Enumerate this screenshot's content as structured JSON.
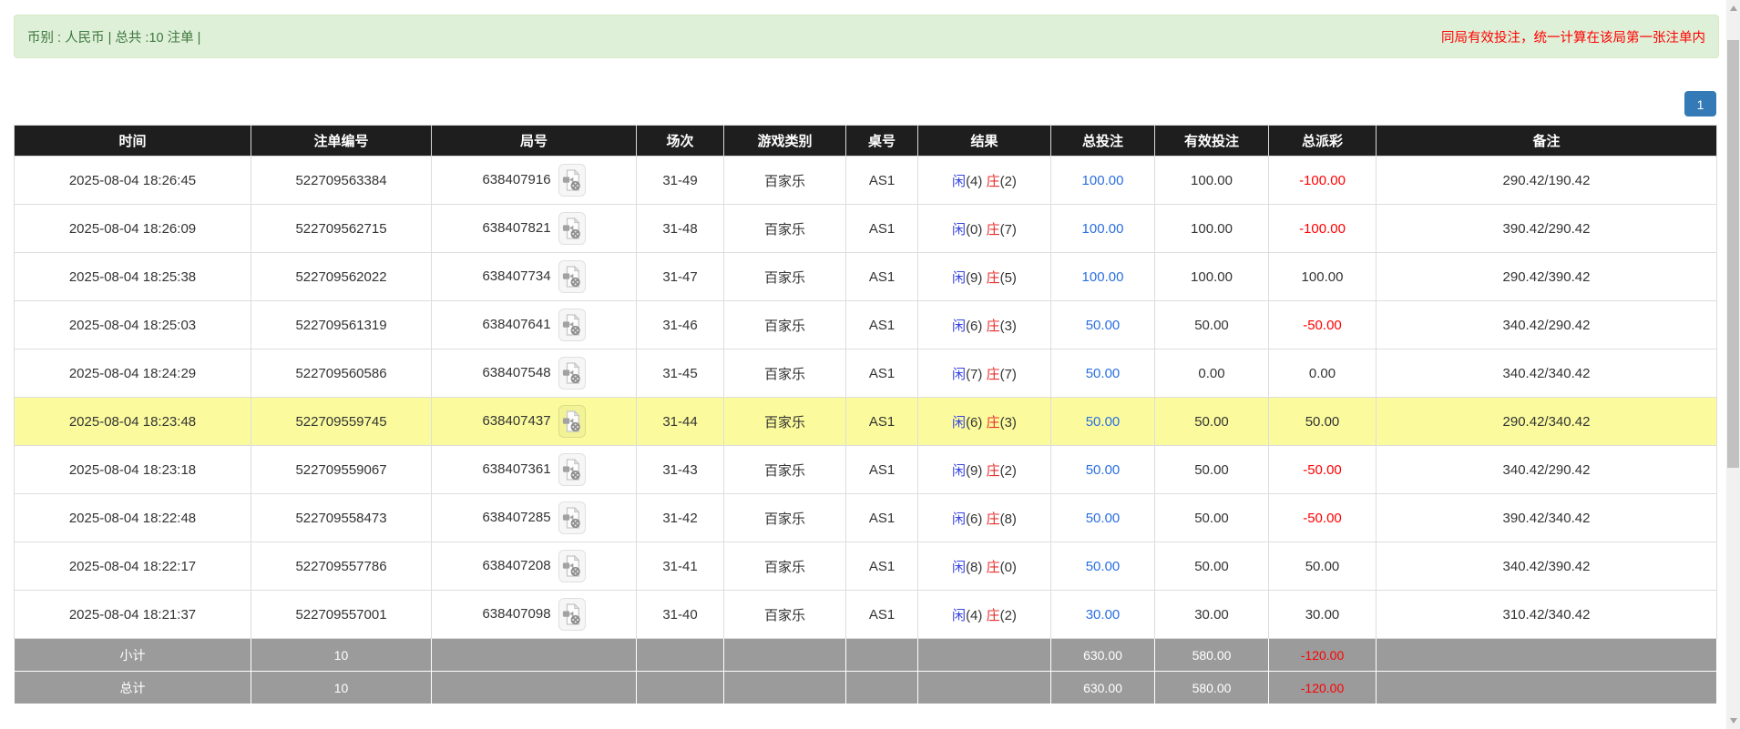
{
  "notice_bar": {
    "left_text": "币别 : 人民币 | 总共 :10 注单 |",
    "right_text": "同局有效投注，统一计算在该局第一张注单内"
  },
  "pagination": {
    "current_page": "1"
  },
  "icons": {
    "round_icon": "video-replay-icon"
  },
  "colors": {
    "notice_bg": "#dff0d8",
    "notice_border": "#d6e9c6",
    "notice_text": "#3c763d",
    "warning_red": "#ff0000",
    "header_bg": "#1e1e1e",
    "highlight_row": "#fbfb9d",
    "footer_bg": "#9b9b9b",
    "link_blue": "#2a6fe0",
    "player_blue": "#3744e0",
    "banker_red": "#e82e2e",
    "pager_blue": "#337ab7"
  },
  "table": {
    "headers": [
      "时间",
      "注单编号",
      "局号",
      "场次",
      "游戏类别",
      "桌号",
      "结果",
      "总投注",
      "有效投注",
      "总派彩",
      "备注"
    ],
    "rows": [
      {
        "time": "2025-08-04 18:26:45",
        "bet_id": "522709563384",
        "round_id": "638407916",
        "session": "31-49",
        "game_type": "百家乐",
        "table_no": "AS1",
        "result": {
          "player_label": "闲",
          "player_points": "(4)",
          "banker_label": "庄",
          "banker_points": "(2)"
        },
        "total_bet": "100.00",
        "valid_bet": "100.00",
        "payout": "-100.00",
        "remark": "290.42/190.42",
        "highlight": false
      },
      {
        "time": "2025-08-04 18:26:09",
        "bet_id": "522709562715",
        "round_id": "638407821",
        "session": "31-48",
        "game_type": "百家乐",
        "table_no": "AS1",
        "result": {
          "player_label": "闲",
          "player_points": "(0)",
          "banker_label": "庄",
          "banker_points": "(7)"
        },
        "total_bet": "100.00",
        "valid_bet": "100.00",
        "payout": "-100.00",
        "remark": "390.42/290.42",
        "highlight": false
      },
      {
        "time": "2025-08-04 18:25:38",
        "bet_id": "522709562022",
        "round_id": "638407734",
        "session": "31-47",
        "game_type": "百家乐",
        "table_no": "AS1",
        "result": {
          "player_label": "闲",
          "player_points": "(9)",
          "banker_label": "庄",
          "banker_points": "(5)"
        },
        "total_bet": "100.00",
        "valid_bet": "100.00",
        "payout": "100.00",
        "remark": "290.42/390.42",
        "highlight": false
      },
      {
        "time": "2025-08-04 18:25:03",
        "bet_id": "522709561319",
        "round_id": "638407641",
        "session": "31-46",
        "game_type": "百家乐",
        "table_no": "AS1",
        "result": {
          "player_label": "闲",
          "player_points": "(6)",
          "banker_label": "庄",
          "banker_points": "(3)"
        },
        "total_bet": "50.00",
        "valid_bet": "50.00",
        "payout": "-50.00",
        "remark": "340.42/290.42",
        "highlight": false
      },
      {
        "time": "2025-08-04 18:24:29",
        "bet_id": "522709560586",
        "round_id": "638407548",
        "session": "31-45",
        "game_type": "百家乐",
        "table_no": "AS1",
        "result": {
          "player_label": "闲",
          "player_points": "(7)",
          "banker_label": "庄",
          "banker_points": "(7)"
        },
        "total_bet": "50.00",
        "valid_bet": "0.00",
        "payout": "0.00",
        "remark": "340.42/340.42",
        "highlight": false
      },
      {
        "time": "2025-08-04 18:23:48",
        "bet_id": "522709559745",
        "round_id": "638407437",
        "session": "31-44",
        "game_type": "百家乐",
        "table_no": "AS1",
        "result": {
          "player_label": "闲",
          "player_points": "(6)",
          "banker_label": "庄",
          "banker_points": "(3)"
        },
        "total_bet": "50.00",
        "valid_bet": "50.00",
        "payout": "50.00",
        "remark": "290.42/340.42",
        "highlight": true
      },
      {
        "time": "2025-08-04 18:23:18",
        "bet_id": "522709559067",
        "round_id": "638407361",
        "session": "31-43",
        "game_type": "百家乐",
        "table_no": "AS1",
        "result": {
          "player_label": "闲",
          "player_points": "(9)",
          "banker_label": "庄",
          "banker_points": "(2)"
        },
        "total_bet": "50.00",
        "valid_bet": "50.00",
        "payout": "-50.00",
        "remark": "340.42/290.42",
        "highlight": false
      },
      {
        "time": "2025-08-04 18:22:48",
        "bet_id": "522709558473",
        "round_id": "638407285",
        "session": "31-42",
        "game_type": "百家乐",
        "table_no": "AS1",
        "result": {
          "player_label": "闲",
          "player_points": "(6)",
          "banker_label": "庄",
          "banker_points": "(8)"
        },
        "total_bet": "50.00",
        "valid_bet": "50.00",
        "payout": "-50.00",
        "remark": "390.42/340.42",
        "highlight": false
      },
      {
        "time": "2025-08-04 18:22:17",
        "bet_id": "522709557786",
        "round_id": "638407208",
        "session": "31-41",
        "game_type": "百家乐",
        "table_no": "AS1",
        "result": {
          "player_label": "闲",
          "player_points": "(8)",
          "banker_label": "庄",
          "banker_points": "(0)"
        },
        "total_bet": "50.00",
        "valid_bet": "50.00",
        "payout": "50.00",
        "remark": "340.42/390.42",
        "highlight": false
      },
      {
        "time": "2025-08-04 18:21:37",
        "bet_id": "522709557001",
        "round_id": "638407098",
        "session": "31-40",
        "game_type": "百家乐",
        "table_no": "AS1",
        "result": {
          "player_label": "闲",
          "player_points": "(4)",
          "banker_label": "庄",
          "banker_points": "(2)"
        },
        "total_bet": "30.00",
        "valid_bet": "30.00",
        "payout": "30.00",
        "remark": "310.42/340.42",
        "highlight": false
      }
    ],
    "footer": [
      {
        "label": "小计",
        "count": "10",
        "total_bet": "630.00",
        "valid_bet": "580.00",
        "payout": "-120.00"
      },
      {
        "label": "总计",
        "count": "10",
        "total_bet": "630.00",
        "valid_bet": "580.00",
        "payout": "-120.00"
      }
    ]
  }
}
